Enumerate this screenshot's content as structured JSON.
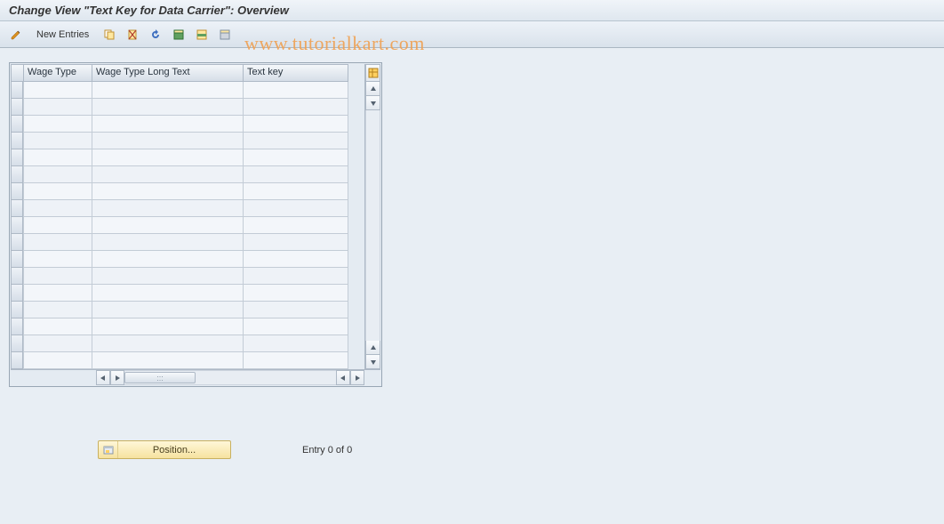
{
  "title": "Change View \"Text Key for Data Carrier\": Overview",
  "toolbar": {
    "new_entries": "New Entries"
  },
  "watermark": "www.tutorialkart.com",
  "table": {
    "columns": {
      "wage_type": "Wage Type",
      "wage_type_long_text": "Wage Type Long Text",
      "text_key": "Text key"
    },
    "rows": [
      {
        "wage_type": "",
        "wage_type_long_text": "",
        "text_key": ""
      },
      {
        "wage_type": "",
        "wage_type_long_text": "",
        "text_key": ""
      },
      {
        "wage_type": "",
        "wage_type_long_text": "",
        "text_key": ""
      },
      {
        "wage_type": "",
        "wage_type_long_text": "",
        "text_key": ""
      },
      {
        "wage_type": "",
        "wage_type_long_text": "",
        "text_key": ""
      },
      {
        "wage_type": "",
        "wage_type_long_text": "",
        "text_key": ""
      },
      {
        "wage_type": "",
        "wage_type_long_text": "",
        "text_key": ""
      },
      {
        "wage_type": "",
        "wage_type_long_text": "",
        "text_key": ""
      },
      {
        "wage_type": "",
        "wage_type_long_text": "",
        "text_key": ""
      },
      {
        "wage_type": "",
        "wage_type_long_text": "",
        "text_key": ""
      },
      {
        "wage_type": "",
        "wage_type_long_text": "",
        "text_key": ""
      },
      {
        "wage_type": "",
        "wage_type_long_text": "",
        "text_key": ""
      },
      {
        "wage_type": "",
        "wage_type_long_text": "",
        "text_key": ""
      },
      {
        "wage_type": "",
        "wage_type_long_text": "",
        "text_key": ""
      },
      {
        "wage_type": "",
        "wage_type_long_text": "",
        "text_key": ""
      },
      {
        "wage_type": "",
        "wage_type_long_text": "",
        "text_key": ""
      },
      {
        "wage_type": "",
        "wage_type_long_text": "",
        "text_key": ""
      }
    ]
  },
  "footer": {
    "position_label": "Position...",
    "entry_text": "Entry 0 of 0"
  }
}
